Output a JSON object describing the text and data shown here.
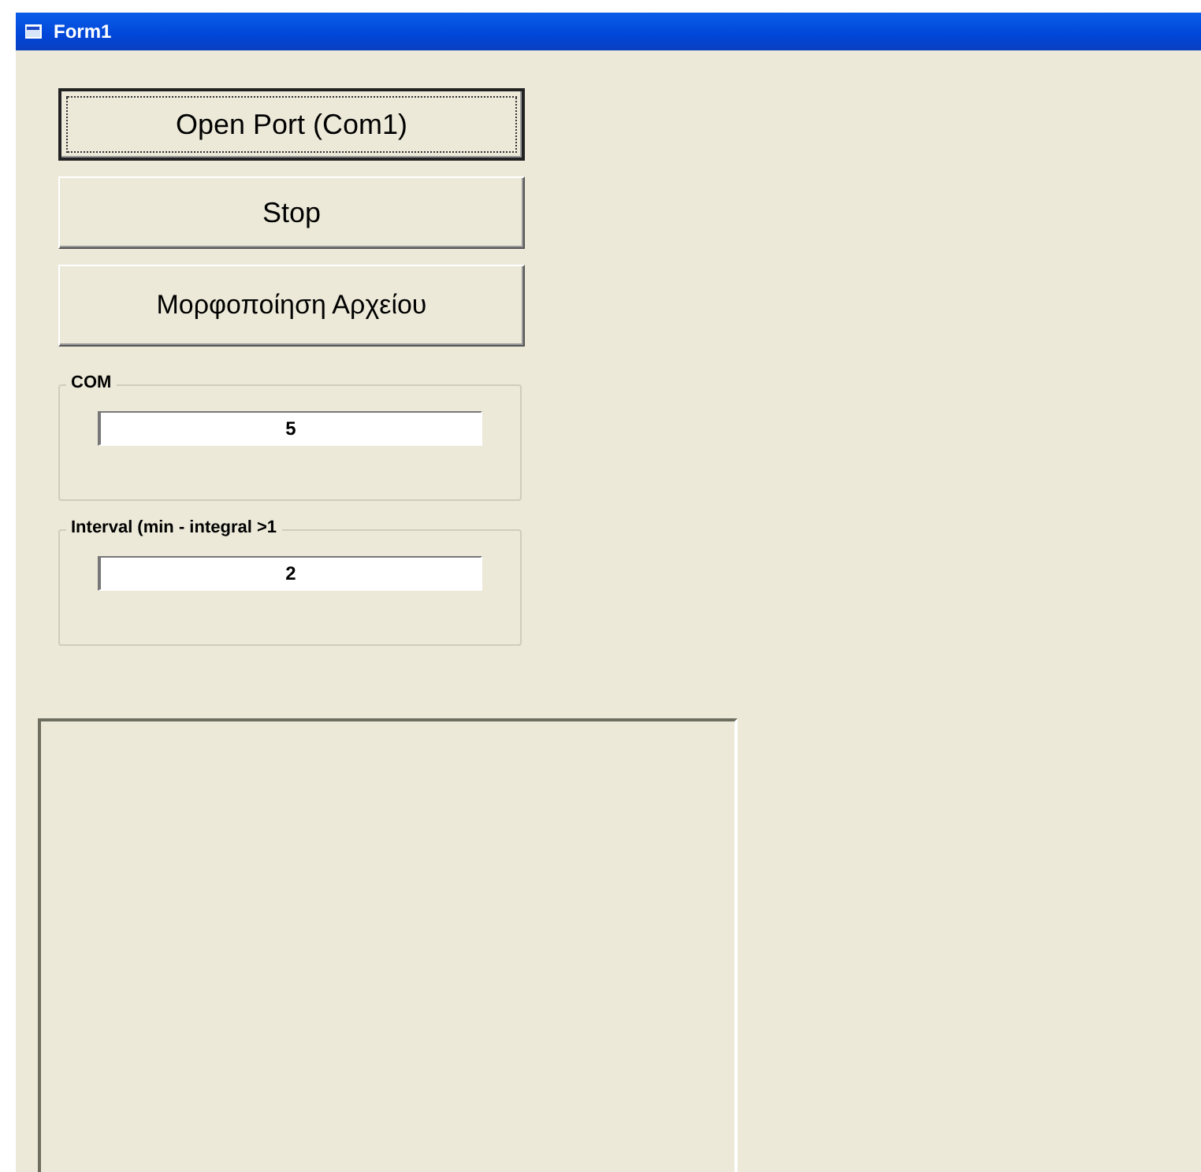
{
  "window": {
    "title": "Form1"
  },
  "buttons": [
    {
      "label": "Open Port (Com1)",
      "focused": true
    },
    {
      "label": "Stop",
      "focused": false
    },
    {
      "label": "Μορφοποίηση Αρχείου",
      "focused": false
    }
  ],
  "frames": [
    {
      "label": "COM",
      "value": "5"
    },
    {
      "label": "Interval (min - integral >1",
      "value": "2"
    }
  ]
}
